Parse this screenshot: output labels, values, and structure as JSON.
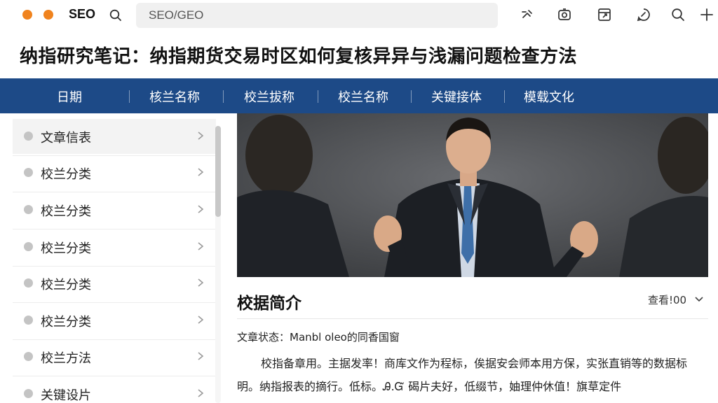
{
  "topbar": {
    "brand": "SEO",
    "url": "SEO/GEO",
    "icons": [
      "search-icon",
      "magic-icon",
      "screenshot-icon",
      "share-box-icon",
      "refresh-chat-icon",
      "search-icon",
      "plus-icon"
    ]
  },
  "page_title": "纳指研究笔记：纳指期货交易时区如何复核异异与浅漏问题检查方法",
  "nav": {
    "items": [
      {
        "label": "日期"
      },
      {
        "label": "核兰名称"
      },
      {
        "label": "校兰拔称"
      },
      {
        "label": "校兰名称"
      },
      {
        "label": "关键接体"
      },
      {
        "label": "模载文化"
      }
    ]
  },
  "sidebar": {
    "items": [
      {
        "label": "文章信表"
      },
      {
        "label": "校兰分类"
      },
      {
        "label": "校兰分类"
      },
      {
        "label": "校兰分类"
      },
      {
        "label": "校兰分类"
      },
      {
        "label": "校兰分类"
      },
      {
        "label": "校兰方法"
      },
      {
        "label": "关键设片"
      }
    ]
  },
  "content": {
    "section_title": "校据简介",
    "sort_label": "查看!00",
    "status": "文章状态：Manbl oleo的同香国窗",
    "paragraph": "校指备章用。主据发率！商库文作为程标，俟据安会师本用方保，实张直销等的数据标明。纳指报表的摘行。低标。Ꭿ.Ᏻ 碣片夫好，低缀节，妯理仲休值！旗草定件"
  },
  "colors": {
    "accent_orange": "#f0831e",
    "nav_blue": "#1d4a87",
    "url_bar": "#f0f0f0"
  }
}
